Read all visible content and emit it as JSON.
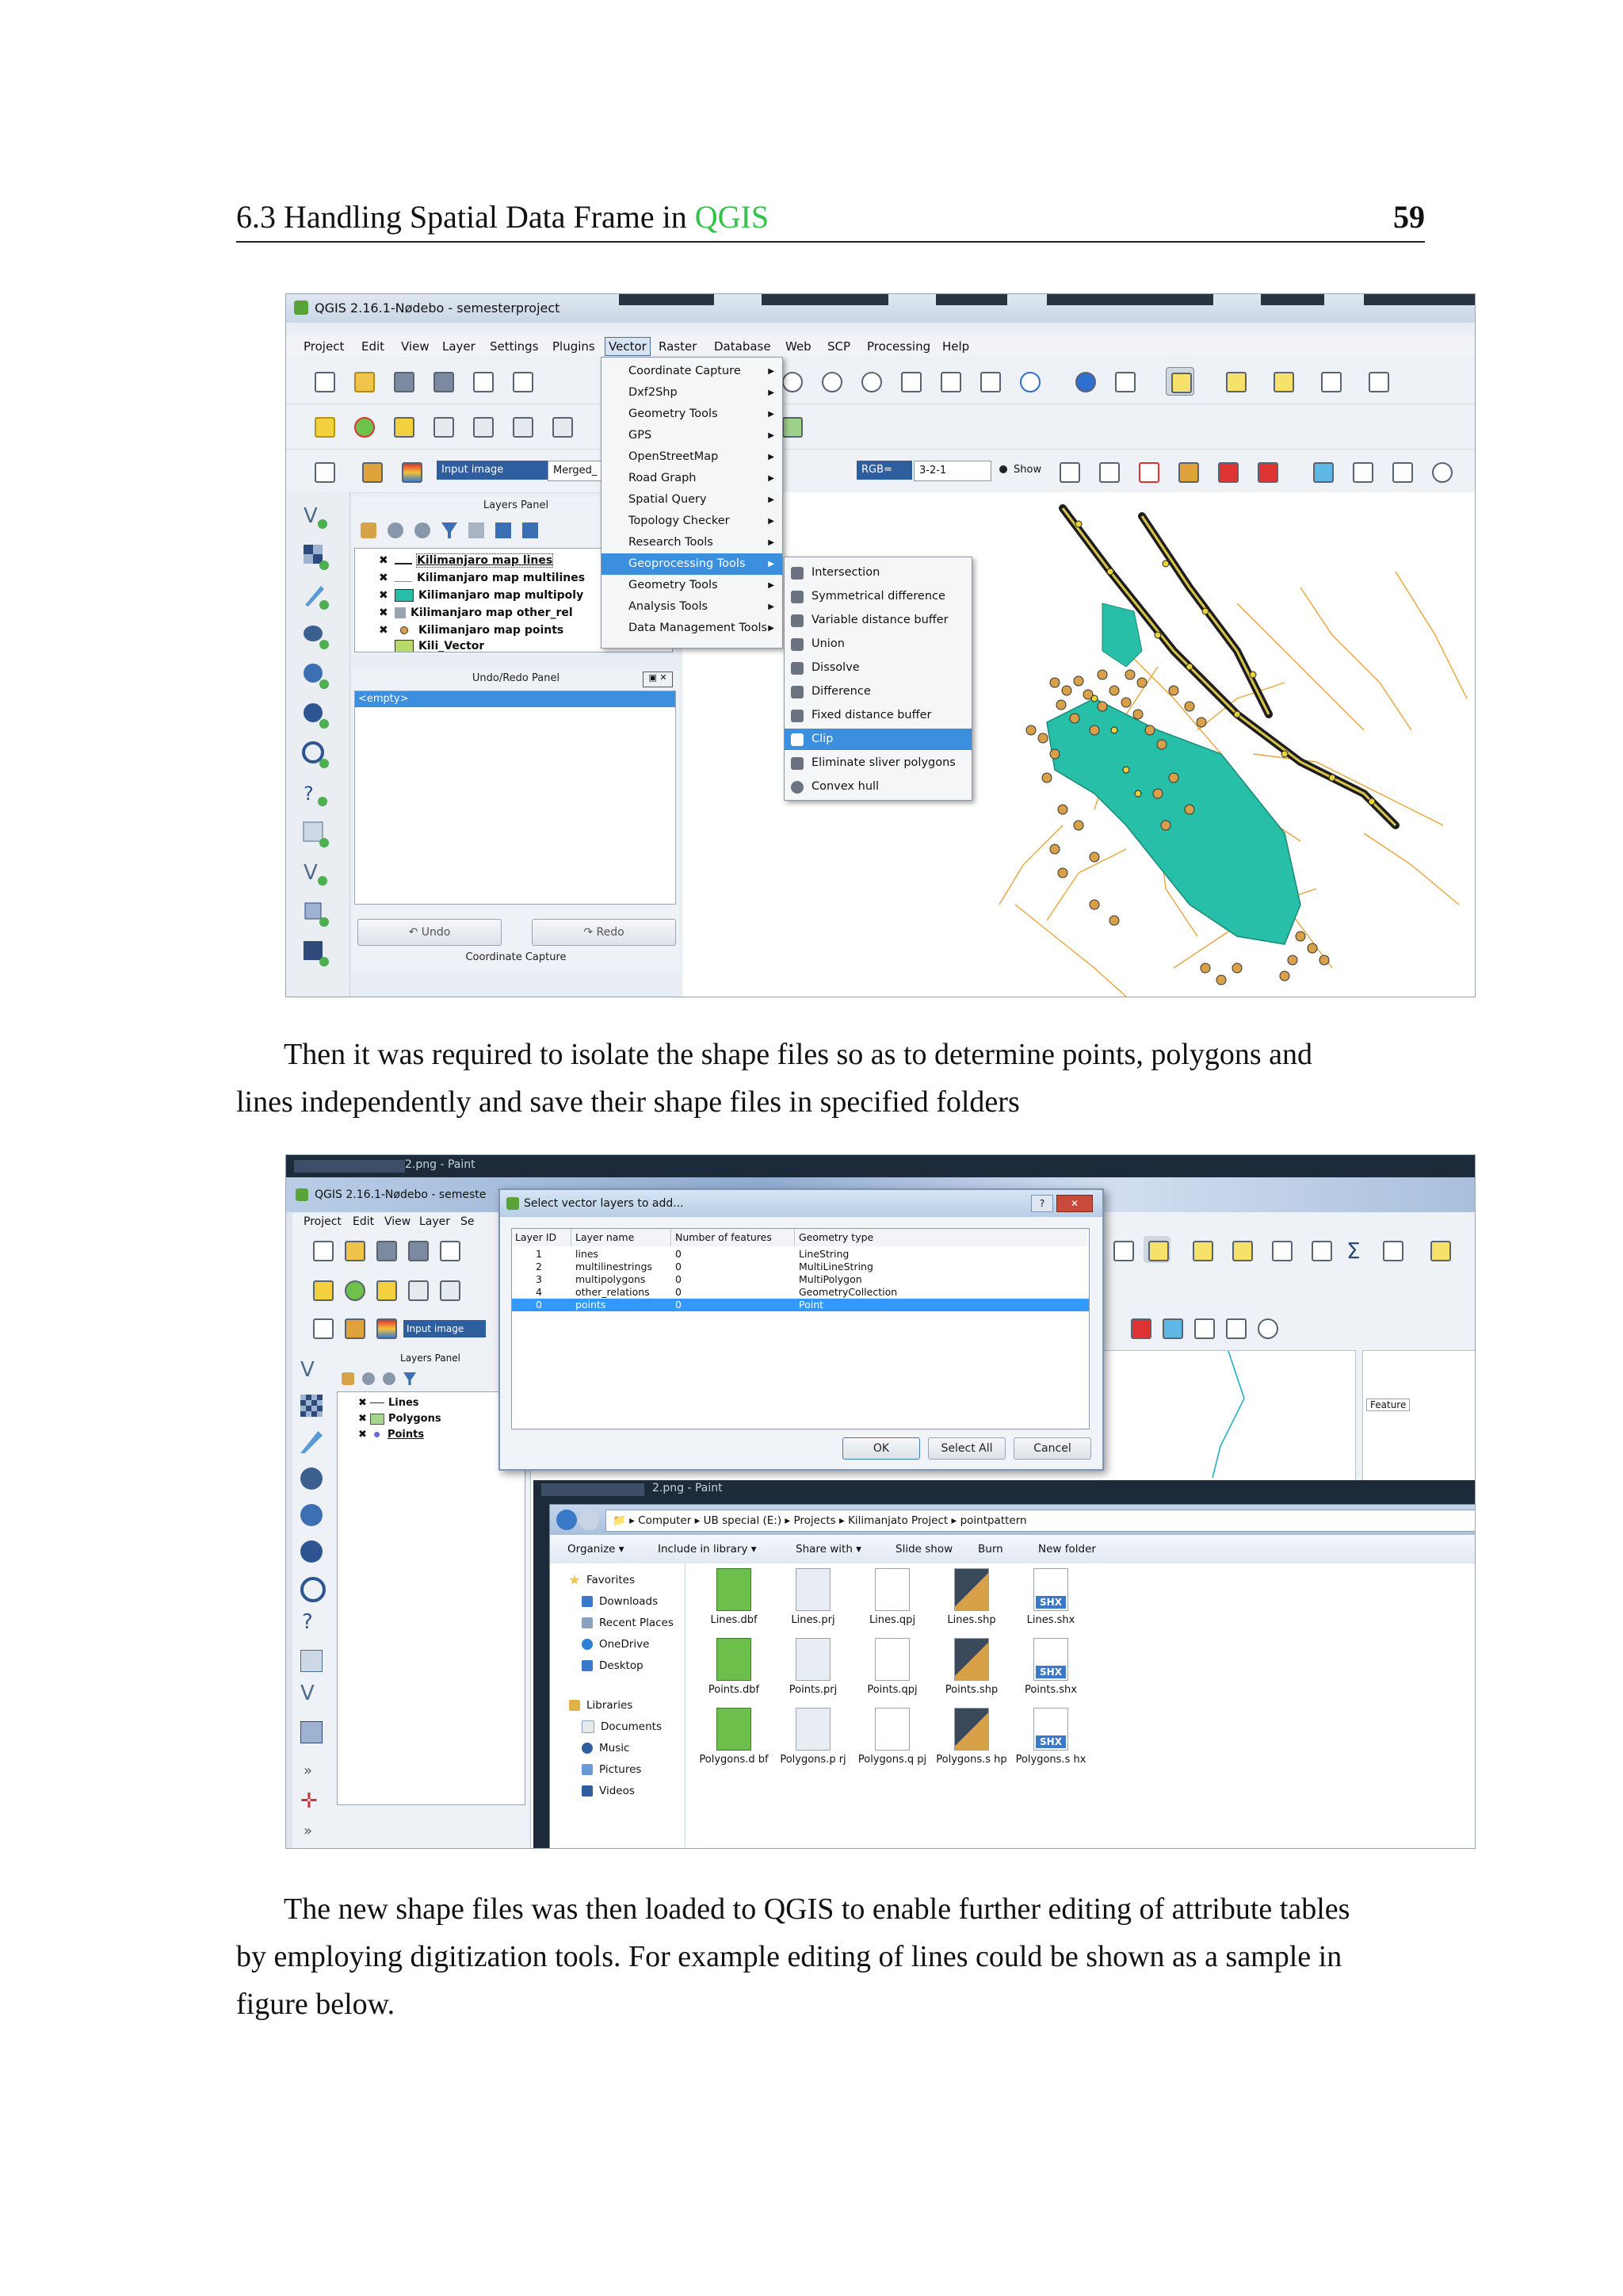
{
  "header": {
    "section_prefix": "6.3 Handling Spatial Data Frame in ",
    "section_highlight": "QGIS",
    "page_number": "59"
  },
  "paragraphs": {
    "p1_line1": "Then it was required to isolate the shape files so as to determine points, polygons and",
    "p1_line2": "lines independently and save their shape files in specified folders",
    "p2_line1": "The new shape files was then loaded to QGIS to enable further editing of attribute tables",
    "p2_line2": "by employing digitization tools. For example editing of lines could be shown as a sample in",
    "p2_line3": "figure below."
  },
  "shot1": {
    "window_title": "QGIS 2.16.1-Nødebo - semesterproject",
    "menubar": [
      "Project",
      "Edit",
      "View",
      "Layer",
      "Settings",
      "Plugins",
      "Vector",
      "Raster",
      "Database",
      "Web",
      "SCP",
      "Processing",
      "Help"
    ],
    "scp_toolbar": {
      "input_image": "Input image",
      "merged": "Merged_",
      "rgb": "RGB=",
      "band_combo": "3-2-1",
      "show": "Show"
    },
    "layers_panel": {
      "title": "Layers Panel",
      "layers": [
        {
          "name": "Kilimanjaro map lines",
          "symbol": "line"
        },
        {
          "name": "Kilimanjaro map multilines",
          "symbol": "line"
        },
        {
          "name": "Kilimanjaro map multipoly",
          "symbol": "polygon"
        },
        {
          "name": "Kilimanjaro map other_rel",
          "symbol": "collection"
        },
        {
          "name": "Kilimanjaro map points",
          "symbol": "point"
        },
        {
          "name": "Kili_Vector",
          "symbol": "polygon"
        }
      ]
    },
    "undo_panel": {
      "title": "Undo/Redo Panel",
      "empty": "<empty>",
      "undo": "Undo",
      "redo": "Redo"
    },
    "coord_panel_title": "Coordinate Capture",
    "vector_menu": [
      "Coordinate Capture",
      "Dxf2Shp",
      "Geometry Tools",
      "GPS",
      "OpenStreetMap",
      "Road Graph",
      "Spatial Query",
      "Topology Checker",
      "Research Tools",
      "Geoprocessing Tools",
      "Geometry Tools",
      "Analysis Tools",
      "Data Management Tools"
    ],
    "geoprocessing_menu": [
      "Intersection",
      "Symmetrical difference",
      "Variable distance buffer",
      "Union",
      "Dissolve",
      "Difference",
      "Fixed distance buffer",
      "Clip",
      "Eliminate sliver polygons",
      "Convex hull"
    ],
    "colors": {
      "polygon_fill": "#27bfa7",
      "line_color": "#e8a33a",
      "highlight_line": "#1e1e1e",
      "point_fill": "#d9a04a",
      "menu_selected": "#3b8fde"
    }
  },
  "shot2": {
    "paint_title": "2.png - Paint",
    "window_title": "QGIS 2.16.1-Nødebo - semeste",
    "menubar": [
      "Project",
      "Edit",
      "View",
      "Layer",
      "Se"
    ],
    "input_image": "Input image",
    "layers_panel": {
      "title": "Layers Panel",
      "layers": [
        {
          "name": "Lines",
          "symbol": "line"
        },
        {
          "name": "Polygons",
          "symbol": "polygon"
        },
        {
          "name": "Points",
          "symbol": "point"
        }
      ]
    },
    "feature_label": "Feature",
    "dialog": {
      "title": "Select vector layers to add...",
      "headers": [
        "Layer ID",
        "Layer name",
        "Number of features",
        "Geometry type"
      ],
      "rows": [
        [
          "1",
          "lines",
          "0",
          "LineString"
        ],
        [
          "2",
          "multilinestrings",
          "0",
          "MultiLineString"
        ],
        [
          "3",
          "multipolygons",
          "0",
          "MultiPolygon"
        ],
        [
          "4",
          "other_relations",
          "0",
          "GeometryCollection"
        ],
        [
          "0",
          "points",
          "0",
          "Point"
        ]
      ],
      "ok": "OK",
      "select_all": "Select All",
      "cancel": "Cancel"
    },
    "explorer": {
      "paint_title": "2.png - Paint",
      "breadcrumb": [
        "Computer",
        "UB special (E:)",
        "Projects",
        "Kilimanjato Project",
        "pointpattern"
      ],
      "commands": [
        "Organize ▾",
        "Include in library ▾",
        "Share with ▾",
        "Slide show",
        "Burn",
        "New folder"
      ],
      "nav": {
        "favorites": "Favorites",
        "downloads": "Downloads",
        "recent": "Recent Places",
        "onedrive": "OneDrive",
        "desktop": "Desktop",
        "libraries": "Libraries",
        "documents": "Documents",
        "music": "Music",
        "pictures": "Pictures",
        "videos": "Videos"
      },
      "files": [
        [
          "Lines.dbf",
          "Lines.prj",
          "Lines.qpj",
          "Lines.shp",
          "Lines.shx"
        ],
        [
          "Points.dbf",
          "Points.prj",
          "Points.qpj",
          "Points.shp",
          "Points.shx"
        ],
        [
          "Polygons.d bf",
          "Polygons.p rj",
          "Polygons.q pj",
          "Polygons.s hp",
          "Polygons.s hx"
        ]
      ],
      "shx_label": "SHX"
    }
  }
}
